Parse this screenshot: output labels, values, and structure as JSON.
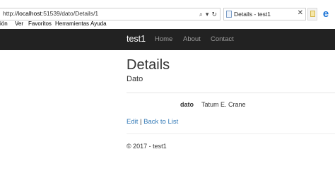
{
  "browser": {
    "url_prefix": "http://",
    "url_host": "localhost",
    "url_path": ":51539/dato/Details/1",
    "tab_title": "Details - test1",
    "tab_close": "✕",
    "menu": [
      "ión",
      "Ver",
      "Favoritos",
      "Herramientas",
      "Ayuda"
    ],
    "icons": {
      "search": "search-icon",
      "dropdown": "chevron-down-icon",
      "refresh": "refresh-icon",
      "new_tab": "new-tab-icon",
      "ie": "internet-explorer-icon"
    }
  },
  "site": {
    "brand": "test1",
    "nav": [
      "Home",
      "About",
      "Contact"
    ]
  },
  "page": {
    "title": "Details",
    "subtitle": "Dato",
    "field_label": "dato",
    "field_value": "Tatum E. Crane",
    "edit_link": "Edit",
    "separator": "|",
    "back_link": "Back to List"
  },
  "footer": {
    "text": "© 2017 - test1"
  },
  "colors": {
    "navbar": "#222222",
    "brand": "#ffffff",
    "nav_link": "#9d9d9d",
    "link": "#337ab7",
    "text": "#333333"
  }
}
